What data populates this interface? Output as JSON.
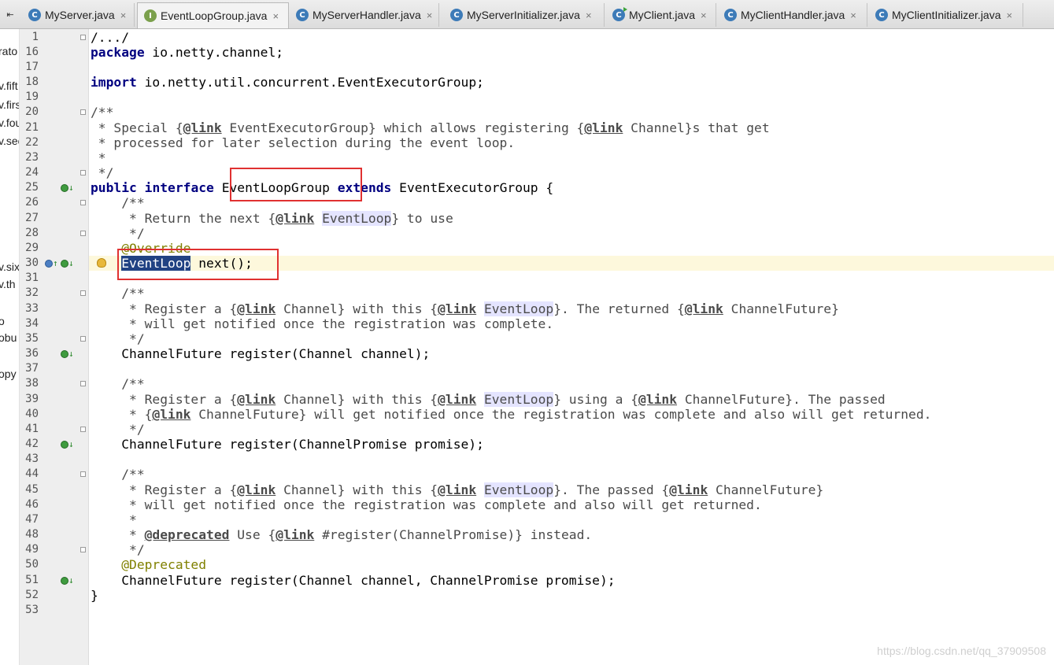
{
  "tabs": [
    {
      "label": "MyServer.java",
      "icon": "class-icon"
    },
    {
      "label": "EventLoopGroup.java",
      "icon": "interface-icon",
      "active": true
    },
    {
      "label": "MyServerHandler.java",
      "icon": "class-icon"
    },
    {
      "label": "MyServerInitializer.java",
      "icon": "class-icon"
    },
    {
      "label": "MyClient.java",
      "icon": "class-icon"
    },
    {
      "label": "MyClientHandler.java",
      "icon": "class-icon"
    },
    {
      "label": "MyClientInitializer.java",
      "icon": "class-icon"
    }
  ],
  "tab_close_glyph": "×",
  "tab_nav_glyph": "⇤",
  "project_fragments": [
    "rato",
    "v.fift",
    "v.firs",
    "v.fou",
    "v.sec",
    "v.six",
    "v.th",
    "o",
    "obu",
    "",
    "opy"
  ],
  "line_numbers": [
    "1",
    "16",
    "17",
    "18",
    "19",
    "20",
    "21",
    "22",
    "23",
    "24",
    "25",
    "26",
    "27",
    "28",
    "29",
    "30",
    "31",
    "32",
    "33",
    "34",
    "35",
    "36",
    "37",
    "38",
    "39",
    "40",
    "41",
    "42",
    "43",
    "44",
    "45",
    "46",
    "47",
    "48",
    "49",
    "50",
    "51",
    "52",
    "53"
  ],
  "code": {
    "l1": "/.../",
    "l16_kw": "package",
    "l16_rest": " io.netty.channel;",
    "l18_kw": "import",
    "l18_rest": " io.netty.util.concurrent.EventExecutorGroup;",
    "l20": "/**",
    "l21_a": " * Special {",
    "l21_tag": "@link",
    "l21_b": " EventExecutorGroup} which allows registering {",
    "l21_tag2": "@link",
    "l21_c": " Channel}s that get",
    "l22": " * processed for later selection during the event loop.",
    "l23": " *",
    "l24": " */",
    "l25_kw1": "public",
    "l25_kw2": "interface",
    "l25_name": "EventLoopGroup",
    "l25_kw3": "extends",
    "l25_rest": " EventExecutorGroup {",
    "l26": "    /**",
    "l27_a": "     * Return the next {",
    "l27_tag": "@link",
    "l27_ref": "EventLoop",
    "l27_b": "} to use",
    "l28": "     */",
    "l29": "    @Override",
    "l30_type": "EventLoop",
    "l30_rest": " next();",
    "l32": "    /**",
    "l33_a": "     * Register a {",
    "l33_tag1": "@link",
    "l33_b": " Channel} with this {",
    "l33_tag2": "@link",
    "l33_ref": "EventLoop",
    "l33_c": "}. The returned {",
    "l33_tag3": "@link",
    "l33_d": " ChannelFuture}",
    "l34": "     * will get notified once the registration was complete.",
    "l35": "     */",
    "l36": "    ChannelFuture register(Channel channel);",
    "l38": "    /**",
    "l39_a": "     * Register a {",
    "l39_tag1": "@link",
    "l39_b": " Channel} with this {",
    "l39_tag2": "@link",
    "l39_ref": "EventLoop",
    "l39_c": "} using a {",
    "l39_tag3": "@link",
    "l39_d": " ChannelFuture}. The passed",
    "l40_a": "     * {",
    "l40_tag": "@link",
    "l40_b": " ChannelFuture} will get notified once the registration was complete and also will get returned.",
    "l41": "     */",
    "l42": "    ChannelFuture register(ChannelPromise promise);",
    "l44": "    /**",
    "l45_a": "     * Register a {",
    "l45_tag1": "@link",
    "l45_b": " Channel} with this {",
    "l45_tag2": "@link",
    "l45_ref": "EventLoop",
    "l45_c": "}. The passed {",
    "l45_tag3": "@link",
    "l45_d": " ChannelFuture}",
    "l46": "     * will get notified once the registration was complete and also will get returned.",
    "l47": "     *",
    "l48_a": "     * ",
    "l48_tag": "@deprecated",
    "l48_b": " Use {",
    "l48_tag2": "@link",
    "l48_c": " #register(ChannelPromise)} instead.",
    "l49": "     */",
    "l50": "    @Deprecated",
    "l51": "    ChannelFuture register(Channel channel, ChannelPromise promise);",
    "l52": "}"
  },
  "watermark": "https://blog.csdn.net/qq_37909508",
  "colors": {
    "keyword": "#000080",
    "selection": "#214283",
    "highlight_box": "#e03131",
    "annotation": "#808000"
  }
}
